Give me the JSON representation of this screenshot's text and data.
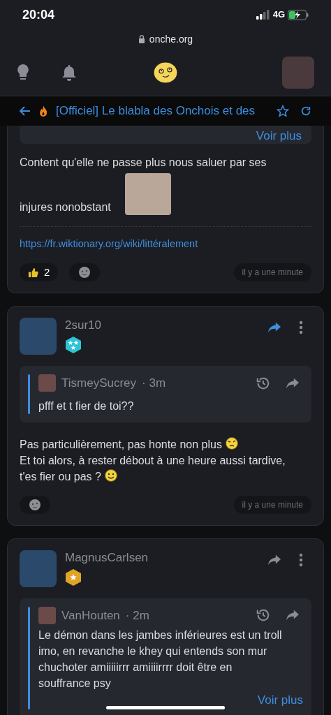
{
  "status_bar": {
    "time": "20:04",
    "network": "4G"
  },
  "url_bar": {
    "domain": "onche.org"
  },
  "topic_bar": {
    "title": "[Officiel] Le blabla des Onchois et des",
    "hot": true,
    "favorite": false
  },
  "posts": [
    {
      "kind": "continued",
      "quote_more": "Voir plus",
      "lines": [
        {
          "text": "Content qu'elle ne passe plus nous saluer par ses",
          "sticker": false
        },
        {
          "text": "injures nonobstant",
          "sticker": true
        }
      ],
      "link": "https://fr.wiktionary.org/wiki/littéralement",
      "likes": "2",
      "time": "il y a une minute"
    },
    {
      "kind": "full",
      "author": "2sur10",
      "badge": {
        "kind": "three-star"
      },
      "share_active": true,
      "quote": {
        "author": "TismeySucrey",
        "age": "· 3m",
        "text": "pfff et t fier de toi??"
      },
      "lines": [
        {
          "text": "Pas particulièrement, pas honte non plus",
          "emoji": {
            "kind": "thinking"
          }
        },
        {
          "text": "Et toi alors, à rester débout à une heure aussi tardive,"
        },
        {
          "text": "t'es fier ou pas ?",
          "emoji": {
            "kind": "smile"
          }
        }
      ],
      "time": "il y a une minute"
    },
    {
      "kind": "full",
      "author": "MagnusCarlsen",
      "badge": {
        "kind": "one-star"
      },
      "share_active": false,
      "quote": {
        "author": "VanHouten",
        "age": "· 2m",
        "text": "Le démon dans les jambes inférieures est un troll imo, en revanche le khey qui entends son mur chuchoter amiiiiirrr amiiiirrrr doit être en souffrance psy",
        "more": "Voir plus"
      }
    }
  ]
}
